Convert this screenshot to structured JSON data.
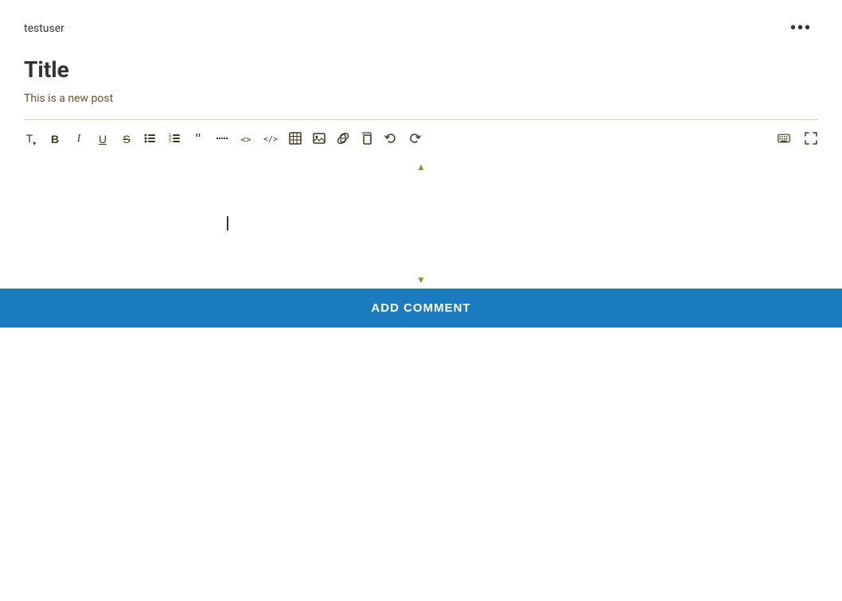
{
  "header": {
    "username": "testuser",
    "more_menu_label": "···"
  },
  "post": {
    "title": "Title",
    "body": "This is a new post"
  },
  "toolbar": {
    "buttons": [
      {
        "name": "text-style",
        "symbol": "T↓",
        "title": "Text Style"
      },
      {
        "name": "bold",
        "symbol": "B",
        "title": "Bold"
      },
      {
        "name": "italic",
        "symbol": "I",
        "title": "Italic"
      },
      {
        "name": "underline",
        "symbol": "U̲",
        "title": "Underline"
      },
      {
        "name": "strikethrough",
        "symbol": "S̶",
        "title": "Strikethrough"
      },
      {
        "name": "bullet-list",
        "symbol": "☰",
        "title": "Bullet List"
      },
      {
        "name": "numbered-list",
        "symbol": "≡",
        "title": "Numbered List"
      },
      {
        "name": "blockquote",
        "symbol": "❝",
        "title": "Blockquote"
      },
      {
        "name": "strikethrough2",
        "symbol": "—",
        "title": "Horizontal Rule"
      },
      {
        "name": "code-inline",
        "symbol": "<>",
        "title": "Inline Code"
      },
      {
        "name": "code-block",
        "symbol": "</>",
        "title": "Code Block"
      },
      {
        "name": "table",
        "symbol": "⊞",
        "title": "Table"
      },
      {
        "name": "image",
        "symbol": "🖼",
        "title": "Image"
      },
      {
        "name": "link",
        "symbol": "🔗",
        "title": "Link"
      },
      {
        "name": "copy",
        "symbol": "⧉",
        "title": "Copy"
      },
      {
        "name": "undo",
        "symbol": "↩",
        "title": "Undo"
      },
      {
        "name": "redo",
        "symbol": "↪",
        "title": "Redo"
      }
    ],
    "right_buttons": [
      {
        "name": "keyboard",
        "symbol": "⌨",
        "title": "Keyboard"
      },
      {
        "name": "fullscreen",
        "symbol": "⛶",
        "title": "Fullscreen"
      }
    ]
  },
  "editor": {
    "placeholder": ""
  },
  "add_comment_button": {
    "label": "ADD COMMENT"
  },
  "colors": {
    "accent_blue": "#1a7bbf",
    "divider_yellow": "#c8c870",
    "text_olive": "#5a5a2a",
    "toolbar_text": "#3a3a1a"
  }
}
